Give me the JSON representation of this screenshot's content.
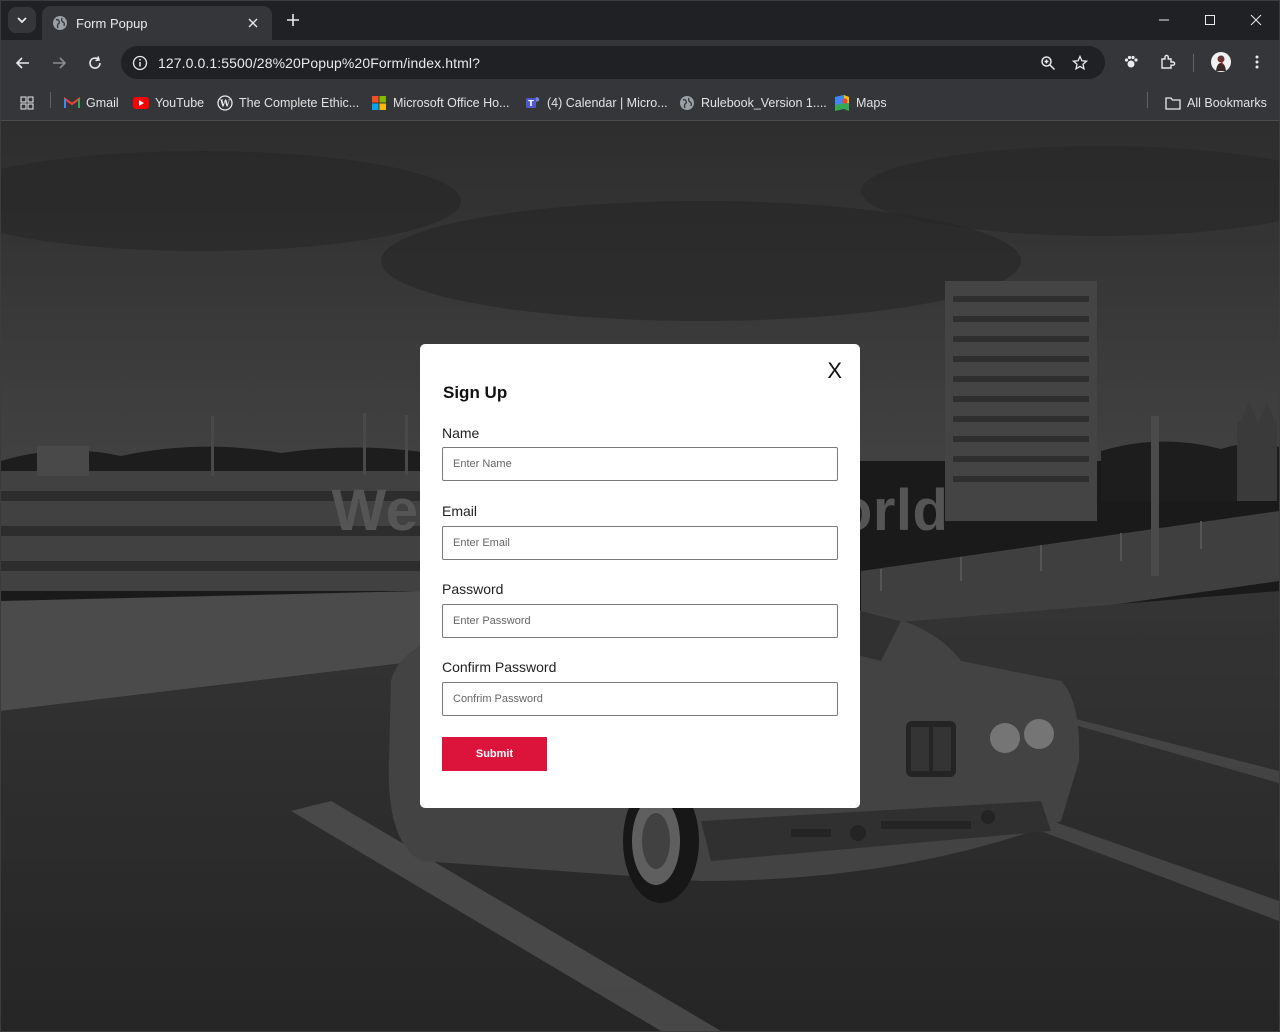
{
  "browser": {
    "tab_title": "Form Popup",
    "url": "127.0.0.1:5500/28%20Popup%20Form/index.html?",
    "bookmarks": [
      {
        "label": "Gmail",
        "icon": "gmail-icon"
      },
      {
        "label": "YouTube",
        "icon": "youtube-icon"
      },
      {
        "label": "The Complete Ethic...",
        "icon": "wordpress-icon"
      },
      {
        "label": "Microsoft Office Ho...",
        "icon": "microsoft-icon"
      },
      {
        "label": "(4) Calendar | Micro...",
        "icon": "teams-icon"
      },
      {
        "label": "Rulebook_Version 1....",
        "icon": "globe-icon"
      },
      {
        "label": "Maps",
        "icon": "maps-icon"
      }
    ],
    "all_bookmarks_label": "All Bookmarks"
  },
  "page": {
    "hero_title": "Welcome to the World",
    "background_description_color": "#2b2b2b"
  },
  "modal": {
    "close_label": "X",
    "title": "Sign Up",
    "fields": [
      {
        "label": "Name",
        "placeholder": "Enter Name",
        "value": ""
      },
      {
        "label": "Email",
        "placeholder": "Enter Email",
        "value": ""
      },
      {
        "label": "Password",
        "placeholder": "Enter Password",
        "value": ""
      },
      {
        "label": "Confirm Password",
        "placeholder": "Confrim Password",
        "value": ""
      }
    ],
    "submit_label": "Submit"
  },
  "colors": {
    "accent": "#dc143c",
    "chrome_dark": "#202124",
    "chrome_mid": "#35363a"
  }
}
